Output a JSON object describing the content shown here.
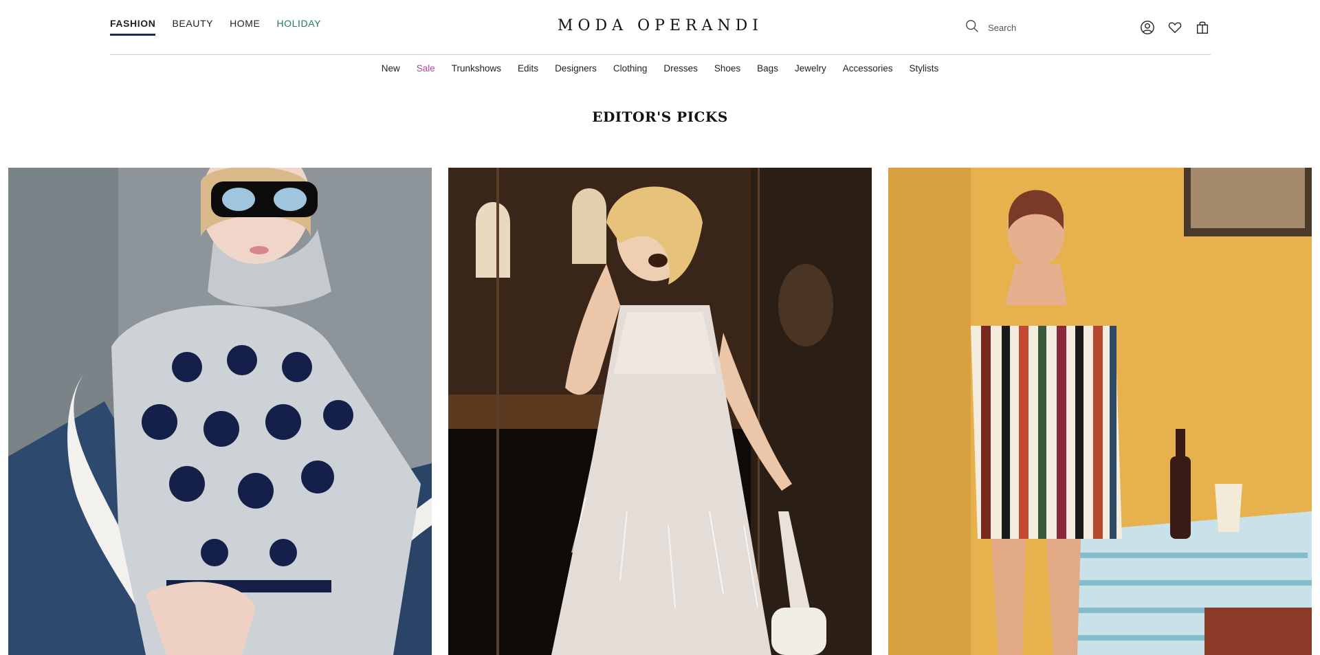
{
  "header": {
    "tabs": [
      {
        "label": "FASHION",
        "active": true
      },
      {
        "label": "BEAUTY"
      },
      {
        "label": "HOME"
      },
      {
        "label": "HOLIDAY",
        "accent": "#1e7a6a"
      }
    ],
    "logo": "MODA OPERANDI",
    "search": {
      "placeholder": "Search",
      "icon": "search-icon"
    },
    "icons": [
      "account-icon",
      "heart-icon",
      "shopping-bag-icon"
    ]
  },
  "subnav": {
    "items": [
      "New",
      "Sale",
      "Trunkshows",
      "Edits",
      "Designers",
      "Clothing",
      "Dresses",
      "Shoes",
      "Bags",
      "Jewelry",
      "Accessories",
      "Stylists"
    ],
    "sale_color": "#b0469a"
  },
  "main": {
    "title": "EDITOR'S PICKS",
    "picks": [
      {
        "name": "pick-knit-sweater"
      },
      {
        "name": "pick-feather-dress"
      },
      {
        "name": "pick-striped-dress"
      }
    ]
  },
  "colors": {
    "active_underline": "#1c2a5c",
    "holiday": "#1e7a6a",
    "sale": "#b0469a"
  }
}
